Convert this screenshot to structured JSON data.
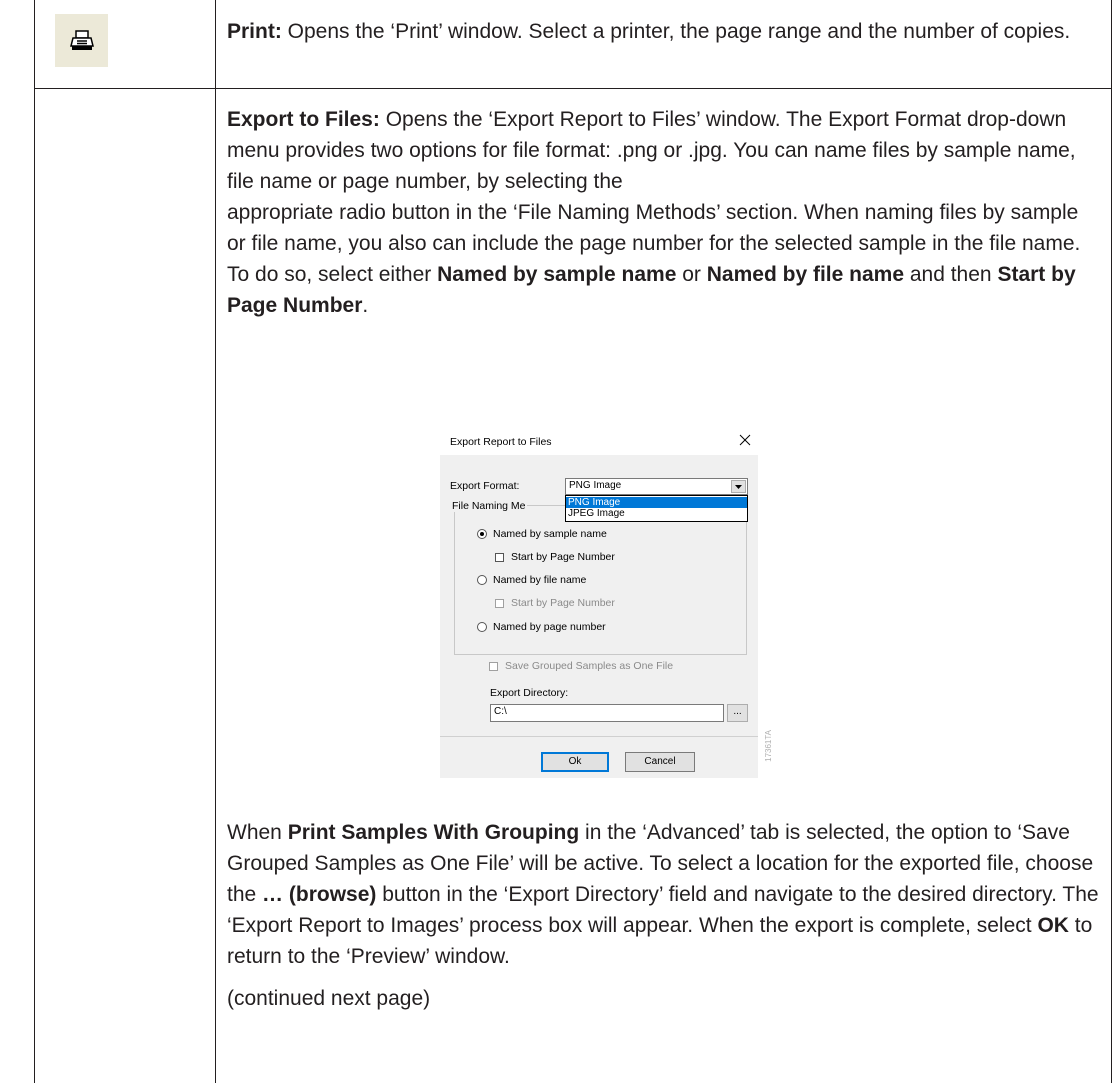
{
  "row1": {
    "icon": "printer-icon",
    "title": "Print:",
    "text": "Opens the ‘Print’ window. Select a printer, the page range and the number of copies."
  },
  "row2": {
    "title": "Export to Files:",
    "para1_a": "Opens the ‘Export Report to Files’ window. The Export Format drop-down menu provides two options for file format: .png or .jpg. You can name files by sample name, file name or page number, by selecting the",
    "para1_b": "appropriate radio button in the ‘File Naming Methods’ section. When naming files by sample or file name, you also can include the page number for the selected sample in the file name. To do so, select either",
    "bold_named_sample": "Named by sample name",
    "or": "or",
    "bold_named_file": "Named by file name",
    "and_then": "and then",
    "bold_start_page": "Start by Page Number",
    "period": ".",
    "para2_a": "When",
    "bold_print_grouping": "Print Samples With Grouping",
    "para2_b": "in the ‘Advanced’ tab is selected, the option to ‘Save Grouped Samples as One File’ will be active. To select a location for the exported file, choose the",
    "bold_browse": "… (browse)",
    "para2_c": "button in the ‘Export Directory’ field and navigate to the desired directory. The ‘Export Report to Images’ process box will appear. When the export is complete, select",
    "bold_ok": "OK",
    "para2_d": "to return to the ‘Preview’ window.",
    "continued": "(continued next page)"
  },
  "dialog": {
    "title": "Export Report to Files",
    "export_format_label": "Export Format:",
    "export_format_value": "PNG Image",
    "dropdown_options": [
      "PNG Image",
      "JPEG Image"
    ],
    "file_naming_label": "File Naming Me",
    "radio_sample": "Named by sample name",
    "chk_start_page_1": "Start by Page Number",
    "radio_file": "Named by file name",
    "chk_start_page_2": "Start by Page Number",
    "radio_page": "Named by page number",
    "chk_save_grouped": "Save Grouped Samples as One File",
    "export_dir_label": "Export Directory:",
    "export_dir_value": "C:\\",
    "browse_label": "...",
    "ok_label": "Ok",
    "cancel_label": "Cancel",
    "figure_id": "17361TA"
  }
}
